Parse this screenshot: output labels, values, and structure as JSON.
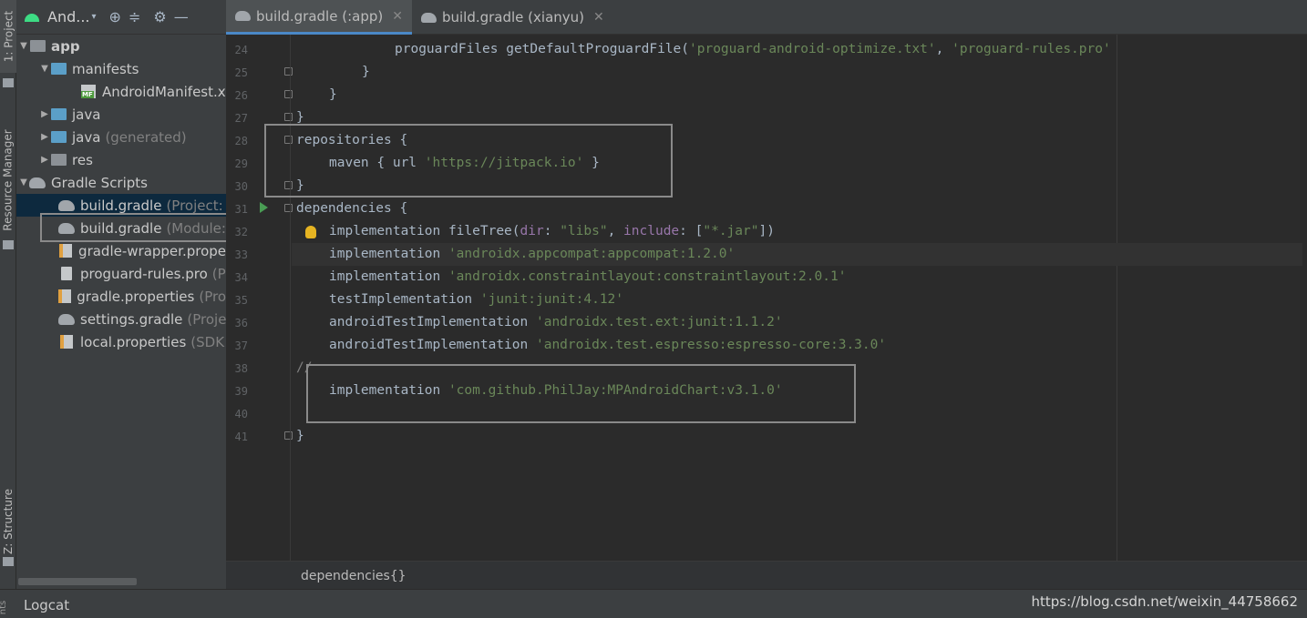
{
  "left_strip": {
    "project_tab": "1: Project",
    "resource_tab": "Resource Manager",
    "structure_tab": "Z: Structure"
  },
  "project_panel": {
    "title": "And...",
    "tree": [
      {
        "label": "app",
        "sub": ""
      },
      {
        "label": "manifests",
        "sub": ""
      },
      {
        "label": "AndroidManifest.x",
        "sub": ""
      },
      {
        "label": "java",
        "sub": ""
      },
      {
        "label": "java",
        "sub": "(generated)"
      },
      {
        "label": "res",
        "sub": ""
      },
      {
        "label": "Gradle Scripts",
        "sub": ""
      },
      {
        "label": "build.gradle",
        "sub": "(Project: "
      },
      {
        "label": "build.gradle",
        "sub": "(Module:"
      },
      {
        "label": "gradle-wrapper.prope",
        "sub": ""
      },
      {
        "label": "proguard-rules.pro",
        "sub": "(P"
      },
      {
        "label": "gradle.properties",
        "sub": "(Pro"
      },
      {
        "label": "settings.gradle",
        "sub": "(Proje"
      },
      {
        "label": "local.properties",
        "sub": "(SDK"
      }
    ]
  },
  "tabs": [
    {
      "label": "build.gradle (:app)"
    },
    {
      "label": "build.gradle (xianyu)"
    }
  ],
  "line_numbers": [
    "24",
    "25",
    "26",
    "27",
    "28",
    "29",
    "30",
    "31",
    "32",
    "33",
    "34",
    "35",
    "36",
    "37",
    "38",
    "39",
    "40",
    "41"
  ],
  "code": {
    "l24_a": "proguardFiles getDefaultProguardFile(",
    "l24_s1": "'proguard-android-optimize.txt'",
    "l24_b": ", ",
    "l24_s2": "'proguard-rules.pro'",
    "l25": "}",
    "l26": "}",
    "l27": "}",
    "l28": "repositories {",
    "l29_a": "maven { url ",
    "l29_s": "'https://jitpack.io'",
    "l29_b": " }",
    "l30": "}",
    "l31": "dependencies {",
    "l32_a": "implementation fileTree(",
    "l32_p1": "dir",
    "l32_b": ": ",
    "l32_s1": "\"libs\"",
    "l32_c": ", ",
    "l32_p2": "include",
    "l32_d": ": [",
    "l32_s2": "\"*.jar\"",
    "l32_e": "])",
    "l33_a": "implementation ",
    "l33_s": "'androidx.appcompat:appcompat:1.2.0'",
    "l34_a": "implementation ",
    "l34_s": "'androidx.constraintlayout:constraintlayout:2.0.1'",
    "l35_a": "testImplementation ",
    "l35_s": "'junit:junit:4.12'",
    "l36_a": "androidTestImplementation ",
    "l36_s": "'androidx.test.ext:junit:1.1.2'",
    "l37_a": "androidTestImplementation ",
    "l37_s": "'androidx.test.espresso:espresso-core:3.3.0'",
    "l38": "//",
    "l39_a": "implementation ",
    "l39_s": "'com.github.PhilJay:MPAndroidChart:v3.1.0'",
    "l41": "}"
  },
  "breadcrumb": "dependencies{}",
  "bottom_bar": {
    "logcat": "Logcat",
    "edge_tab": "nts",
    "watermark": "https://blog.csdn.net/weixin_44758662"
  }
}
